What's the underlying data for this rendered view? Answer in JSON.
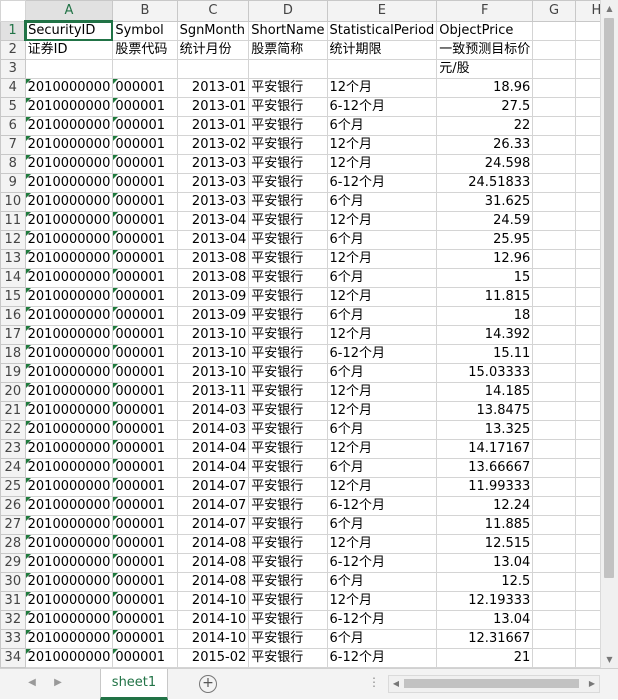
{
  "columns": [
    "A",
    "B",
    "C",
    "D",
    "E",
    "F",
    "G",
    "H"
  ],
  "selected_column": "A",
  "selected_row": "1",
  "header_row1": [
    "SecurityID",
    "Symbol",
    "SgnMonth",
    "ShortName",
    "StatisticalPeriod",
    "ObjectPrice"
  ],
  "header_row2": [
    "证券ID",
    "股票代码",
    "统计月份",
    "股票简称",
    "统计期限",
    "一致预测目标价"
  ],
  "row3_f": "元/股",
  "rows": [
    {
      "n": "4",
      "a": "2010000000",
      "b": "000001",
      "c": "2013-01",
      "d": "平安银行",
      "e": "12个月",
      "f": "18.96"
    },
    {
      "n": "5",
      "a": "2010000000",
      "b": "000001",
      "c": "2013-01",
      "d": "平安银行",
      "e": "6-12个月",
      "f": "27.5"
    },
    {
      "n": "6",
      "a": "2010000000",
      "b": "000001",
      "c": "2013-01",
      "d": "平安银行",
      "e": "6个月",
      "f": "22"
    },
    {
      "n": "7",
      "a": "2010000000",
      "b": "000001",
      "c": "2013-02",
      "d": "平安银行",
      "e": "12个月",
      "f": "26.33"
    },
    {
      "n": "8",
      "a": "2010000000",
      "b": "000001",
      "c": "2013-03",
      "d": "平安银行",
      "e": "12个月",
      "f": "24.598"
    },
    {
      "n": "9",
      "a": "2010000000",
      "b": "000001",
      "c": "2013-03",
      "d": "平安银行",
      "e": "6-12个月",
      "f": "24.51833"
    },
    {
      "n": "10",
      "a": "2010000000",
      "b": "000001",
      "c": "2013-03",
      "d": "平安银行",
      "e": "6个月",
      "f": "31.625"
    },
    {
      "n": "11",
      "a": "2010000000",
      "b": "000001",
      "c": "2013-04",
      "d": "平安银行",
      "e": "12个月",
      "f": "24.59"
    },
    {
      "n": "12",
      "a": "2010000000",
      "b": "000001",
      "c": "2013-04",
      "d": "平安银行",
      "e": "6个月",
      "f": "25.95"
    },
    {
      "n": "13",
      "a": "2010000000",
      "b": "000001",
      "c": "2013-08",
      "d": "平安银行",
      "e": "12个月",
      "f": "12.96"
    },
    {
      "n": "14",
      "a": "2010000000",
      "b": "000001",
      "c": "2013-08",
      "d": "平安银行",
      "e": "6个月",
      "f": "15"
    },
    {
      "n": "15",
      "a": "2010000000",
      "b": "000001",
      "c": "2013-09",
      "d": "平安银行",
      "e": "12个月",
      "f": "11.815"
    },
    {
      "n": "16",
      "a": "2010000000",
      "b": "000001",
      "c": "2013-09",
      "d": "平安银行",
      "e": "6个月",
      "f": "18"
    },
    {
      "n": "17",
      "a": "2010000000",
      "b": "000001",
      "c": "2013-10",
      "d": "平安银行",
      "e": "12个月",
      "f": "14.392"
    },
    {
      "n": "18",
      "a": "2010000000",
      "b": "000001",
      "c": "2013-10",
      "d": "平安银行",
      "e": "6-12个月",
      "f": "15.11"
    },
    {
      "n": "19",
      "a": "2010000000",
      "b": "000001",
      "c": "2013-10",
      "d": "平安银行",
      "e": "6个月",
      "f": "15.03333"
    },
    {
      "n": "20",
      "a": "2010000000",
      "b": "000001",
      "c": "2013-11",
      "d": "平安银行",
      "e": "12个月",
      "f": "14.185"
    },
    {
      "n": "21",
      "a": "2010000000",
      "b": "000001",
      "c": "2014-03",
      "d": "平安银行",
      "e": "12个月",
      "f": "13.8475"
    },
    {
      "n": "22",
      "a": "2010000000",
      "b": "000001",
      "c": "2014-03",
      "d": "平安银行",
      "e": "6个月",
      "f": "13.325"
    },
    {
      "n": "23",
      "a": "2010000000",
      "b": "000001",
      "c": "2014-04",
      "d": "平安银行",
      "e": "12个月",
      "f": "14.17167"
    },
    {
      "n": "24",
      "a": "2010000000",
      "b": "000001",
      "c": "2014-04",
      "d": "平安银行",
      "e": "6个月",
      "f": "13.66667"
    },
    {
      "n": "25",
      "a": "2010000000",
      "b": "000001",
      "c": "2014-07",
      "d": "平安银行",
      "e": "12个月",
      "f": "11.99333"
    },
    {
      "n": "26",
      "a": "2010000000",
      "b": "000001",
      "c": "2014-07",
      "d": "平安银行",
      "e": "6-12个月",
      "f": "12.24"
    },
    {
      "n": "27",
      "a": "2010000000",
      "b": "000001",
      "c": "2014-07",
      "d": "平安银行",
      "e": "6个月",
      "f": "11.885"
    },
    {
      "n": "28",
      "a": "2010000000",
      "b": "000001",
      "c": "2014-08",
      "d": "平安银行",
      "e": "12个月",
      "f": "12.515"
    },
    {
      "n": "29",
      "a": "2010000000",
      "b": "000001",
      "c": "2014-08",
      "d": "平安银行",
      "e": "6-12个月",
      "f": "13.04"
    },
    {
      "n": "30",
      "a": "2010000000",
      "b": "000001",
      "c": "2014-08",
      "d": "平安银行",
      "e": "6个月",
      "f": "12.5"
    },
    {
      "n": "31",
      "a": "2010000000",
      "b": "000001",
      "c": "2014-10",
      "d": "平安银行",
      "e": "12个月",
      "f": "12.19333"
    },
    {
      "n": "32",
      "a": "2010000000",
      "b": "000001",
      "c": "2014-10",
      "d": "平安银行",
      "e": "6-12个月",
      "f": "13.04"
    },
    {
      "n": "33",
      "a": "2010000000",
      "b": "000001",
      "c": "2014-10",
      "d": "平安银行",
      "e": "6个月",
      "f": "12.31667"
    },
    {
      "n": "34",
      "a": "2010000000",
      "b": "000001",
      "c": "2015-02",
      "d": "平安银行",
      "e": "6-12个月",
      "f": "21"
    }
  ],
  "sheet_tabs": [
    "sheet1"
  ],
  "add_sheet_symbol": "+",
  "scroll_dots": "⋮",
  "accent_color": "#217346"
}
